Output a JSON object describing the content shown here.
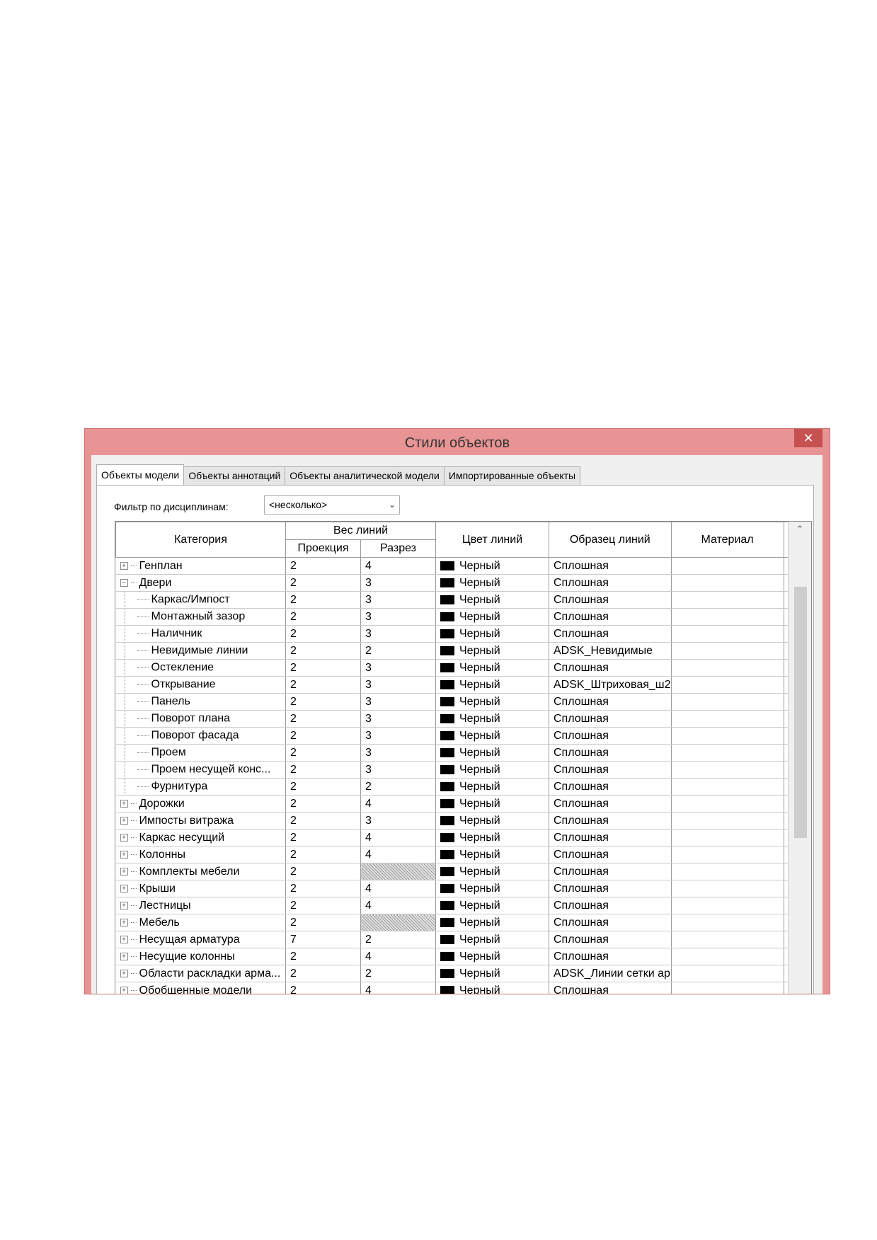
{
  "window": {
    "title": "Стили объектов",
    "close": "✕"
  },
  "tabs": [
    {
      "label": "Объекты модели",
      "active": true
    },
    {
      "label": "Объекты аннотаций",
      "active": false
    },
    {
      "label": "Объекты аналитической модели",
      "active": false
    },
    {
      "label": "Импортированные объекты",
      "active": false
    }
  ],
  "filter": {
    "label": "Фильтр по дисциплинам:",
    "value": "<несколько>"
  },
  "table": {
    "headers": {
      "category": "Категория",
      "line_weight": "Вес линий",
      "projection": "Проекция",
      "cut": "Разрез",
      "line_color": "Цвет линий",
      "line_pattern": "Образец линий",
      "material": "Материал"
    },
    "rows": [
      {
        "name": "Генплан",
        "level": 0,
        "exp": "+",
        "proj": "2",
        "cut": "4",
        "color": "Черный",
        "pattern": "Сплошная",
        "material": ""
      },
      {
        "name": "Двери",
        "level": 0,
        "exp": "−",
        "proj": "2",
        "cut": "3",
        "color": "Черный",
        "pattern": "Сплошная",
        "material": ""
      },
      {
        "name": "Каркас/Импост",
        "level": 1,
        "proj": "2",
        "cut": "3",
        "color": "Черный",
        "pattern": "Сплошная",
        "material": ""
      },
      {
        "name": "Монтажный зазор",
        "level": 1,
        "proj": "2",
        "cut": "3",
        "color": "Черный",
        "pattern": "Сплошная",
        "material": ""
      },
      {
        "name": "Наличник",
        "level": 1,
        "proj": "2",
        "cut": "3",
        "color": "Черный",
        "pattern": "Сплошная",
        "material": ""
      },
      {
        "name": "Невидимые линии",
        "level": 1,
        "proj": "2",
        "cut": "2",
        "color": "Черный",
        "pattern": "ADSK_Невидимые",
        "material": ""
      },
      {
        "name": "Остекление",
        "level": 1,
        "proj": "2",
        "cut": "3",
        "color": "Черный",
        "pattern": "Сплошная",
        "material": ""
      },
      {
        "name": "Открывание",
        "level": 1,
        "proj": "2",
        "cut": "3",
        "color": "Черный",
        "pattern": "ADSK_Штриховая_ш2",
        "material": ""
      },
      {
        "name": "Панель",
        "level": 1,
        "proj": "2",
        "cut": "3",
        "color": "Черный",
        "pattern": "Сплошная",
        "material": ""
      },
      {
        "name": "Поворот плана",
        "level": 1,
        "proj": "2",
        "cut": "3",
        "color": "Черный",
        "pattern": "Сплошная",
        "material": ""
      },
      {
        "name": "Поворот фасада",
        "level": 1,
        "proj": "2",
        "cut": "3",
        "color": "Черный",
        "pattern": "Сплошная",
        "material": ""
      },
      {
        "name": "Проем",
        "level": 1,
        "proj": "2",
        "cut": "3",
        "color": "Черный",
        "pattern": "Сплошная",
        "material": ""
      },
      {
        "name": "Проем несущей конс...",
        "level": 1,
        "proj": "2",
        "cut": "3",
        "color": "Черный",
        "pattern": "Сплошная",
        "material": ""
      },
      {
        "name": "Фурнитура",
        "level": 1,
        "proj": "2",
        "cut": "2",
        "color": "Черный",
        "pattern": "Сплошная",
        "material": ""
      },
      {
        "name": "Дорожки",
        "level": 0,
        "exp": "+",
        "proj": "2",
        "cut": "4",
        "color": "Черный",
        "pattern": "Сплошная",
        "material": ""
      },
      {
        "name": "Импосты витража",
        "level": 0,
        "exp": "+",
        "proj": "2",
        "cut": "3",
        "color": "Черный",
        "pattern": "Сплошная",
        "material": ""
      },
      {
        "name": "Каркас несущий",
        "level": 0,
        "exp": "+",
        "proj": "2",
        "cut": "4",
        "color": "Черный",
        "pattern": "Сплошная",
        "material": ""
      },
      {
        "name": "Колонны",
        "level": 0,
        "exp": "+",
        "proj": "2",
        "cut": "4",
        "color": "Черный",
        "pattern": "Сплошная",
        "material": ""
      },
      {
        "name": "Комплекты мебели",
        "level": 0,
        "exp": "+",
        "proj": "2",
        "cut": "",
        "hatched": true,
        "color": "Черный",
        "pattern": "Сплошная",
        "material": ""
      },
      {
        "name": "Крыши",
        "level": 0,
        "exp": "+",
        "proj": "2",
        "cut": "4",
        "color": "Черный",
        "pattern": "Сплошная",
        "material": ""
      },
      {
        "name": "Лестницы",
        "level": 0,
        "exp": "+",
        "proj": "2",
        "cut": "4",
        "color": "Черный",
        "pattern": "Сплошная",
        "material": ""
      },
      {
        "name": "Мебель",
        "level": 0,
        "exp": "+",
        "proj": "2",
        "cut": "",
        "hatched": true,
        "color": "Черный",
        "pattern": "Сплошная",
        "material": ""
      },
      {
        "name": "Несущая арматура",
        "level": 0,
        "exp": "+",
        "proj": "7",
        "cut": "2",
        "color": "Черный",
        "pattern": "Сплошная",
        "material": ""
      },
      {
        "name": "Несущие колонны",
        "level": 0,
        "exp": "+",
        "proj": "2",
        "cut": "4",
        "color": "Черный",
        "pattern": "Сплошная",
        "material": ""
      },
      {
        "name": "Области раскладки арма...",
        "level": 0,
        "exp": "+",
        "proj": "2",
        "cut": "2",
        "color": "Черный",
        "pattern": "ADSK_Линии сетки ар",
        "material": ""
      },
      {
        "name": "Обобщенные модели",
        "level": 0,
        "exp": "+",
        "proj": "2",
        "cut": "4",
        "color": "Черный",
        "pattern": "Сплошная",
        "material": ""
      }
    ]
  },
  "scrollbar": {
    "up_icon": "chevron-up-icon"
  }
}
